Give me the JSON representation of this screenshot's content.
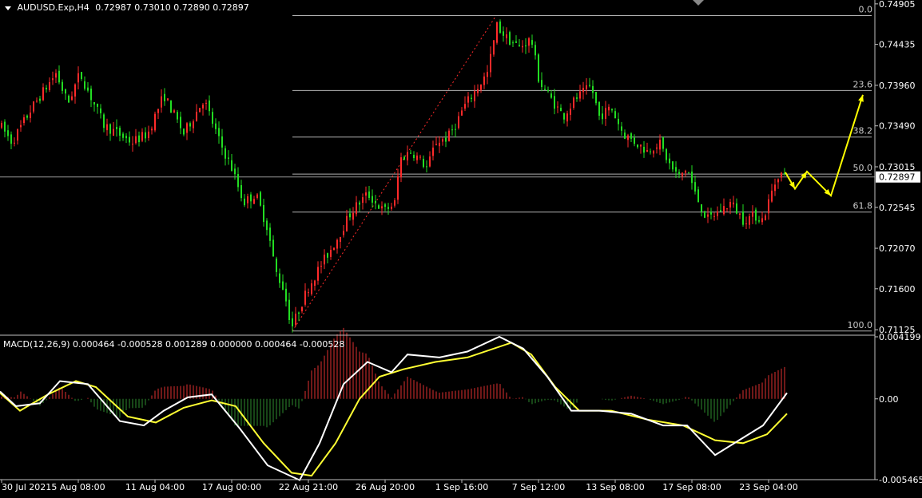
{
  "header": {
    "symbol": "AUDUSD.Exp,H4",
    "ohlc": "0.72987 0.73010 0.72890 0.72897"
  },
  "colors": {
    "background": "#000000",
    "bull": "#ff2a2a",
    "bear": "#22dd22",
    "grid": "#c0c0c0",
    "fib": "#b0b0b0",
    "fib_trend": "#ff2a2a",
    "macd_line": "#ffffff",
    "signal_line": "#ffff33",
    "hist_pos": "#e03030",
    "hist_neg": "#2e8b2e",
    "projection": "#ffff00"
  },
  "price_axis": {
    "ticks": [
      "0.74905",
      "0.74435",
      "0.73960",
      "0.73490",
      "0.73015",
      "0.72545",
      "0.72070",
      "0.71600",
      "0.71125"
    ],
    "current": "0.72897"
  },
  "fib_levels": [
    {
      "label": "0.0",
      "price": 0.7477
    },
    {
      "label": "23.6",
      "price": 0.739
    },
    {
      "label": "38.2",
      "price": 0.7336
    },
    {
      "label": "50.0",
      "price": 0.7293
    },
    {
      "label": "61.8",
      "price": 0.7249
    },
    {
      "label": "100.0",
      "price": 0.7111
    }
  ],
  "macd": {
    "label": "MACD(12,26,9) 0.000464 -0.000528 0.001289 0.000000 0.000464 -0.000528",
    "ticks": [
      "0.004199",
      "0.00",
      "-0.005465"
    ]
  },
  "time_axis": {
    "labels": [
      "30 Jul 2021",
      "5 Aug 08:00",
      "11 Aug 04:00",
      "17 Aug 00:00",
      "22 Aug 21:00",
      "26 Aug 20:00",
      "1 Sep 16:00",
      "7 Sep 12:00",
      "13 Sep 08:00",
      "17 Sep 08:00",
      "23 Sep 04:00"
    ]
  },
  "chart_data": [
    {
      "type": "candlestick",
      "symbol": "AUDUSD.Exp",
      "timeframe": "H4",
      "ylim": [
        0.7108,
        0.7495
      ],
      "price_path": [
        [
          0,
          0.735
        ],
        [
          15,
          0.733
        ],
        [
          40,
          0.737
        ],
        [
          70,
          0.741
        ],
        [
          85,
          0.7375
        ],
        [
          100,
          0.741
        ],
        [
          130,
          0.735
        ],
        [
          165,
          0.733
        ],
        [
          185,
          0.734
        ],
        [
          205,
          0.7385
        ],
        [
          230,
          0.734
        ],
        [
          255,
          0.738
        ],
        [
          275,
          0.733
        ],
        [
          290,
          0.73
        ],
        [
          305,
          0.726
        ],
        [
          320,
          0.727
        ],
        [
          335,
          0.723
        ],
        [
          345,
          0.718
        ],
        [
          355,
          0.716
        ],
        [
          365,
          0.7115
        ],
        [
          385,
          0.716
        ],
        [
          400,
          0.7185
        ],
        [
          420,
          0.7215
        ],
        [
          440,
          0.725
        ],
        [
          460,
          0.727
        ],
        [
          480,
          0.725
        ],
        [
          495,
          0.726
        ],
        [
          500,
          0.731
        ],
        [
          515,
          0.732
        ],
        [
          535,
          0.73
        ],
        [
          545,
          0.733
        ],
        [
          560,
          0.7335
        ],
        [
          570,
          0.735
        ],
        [
          580,
          0.737
        ],
        [
          595,
          0.739
        ],
        [
          610,
          0.741
        ],
        [
          622,
          0.7465
        ],
        [
          635,
          0.745
        ],
        [
          650,
          0.744
        ],
        [
          665,
          0.745
        ],
        [
          675,
          0.74
        ],
        [
          690,
          0.738
        ],
        [
          705,
          0.736
        ],
        [
          720,
          0.738
        ],
        [
          740,
          0.7395
        ],
        [
          750,
          0.736
        ],
        [
          765,
          0.737
        ],
        [
          780,
          0.734
        ],
        [
          795,
          0.733
        ],
        [
          810,
          0.732
        ],
        [
          825,
          0.733
        ],
        [
          840,
          0.73
        ],
        [
          850,
          0.729
        ],
        [
          860,
          0.73
        ],
        [
          870,
          0.727
        ],
        [
          885,
          0.724
        ],
        [
          900,
          0.725
        ],
        [
          915,
          0.726
        ],
        [
          930,
          0.724
        ],
        [
          945,
          0.7245
        ],
        [
          955,
          0.724
        ],
        [
          965,
          0.727
        ],
        [
          975,
          0.7295
        ],
        [
          983,
          0.729
        ]
      ],
      "fib_retracement": {
        "high": 0.7477,
        "low": 0.7111
      },
      "projection": [
        [
          983,
          0.7295
        ],
        [
          995,
          0.7276
        ],
        [
          1010,
          0.7296
        ],
        [
          1040,
          0.7268
        ],
        [
          1080,
          0.7385
        ]
      ]
    },
    {
      "type": "line",
      "indicator": "MACD(12,26,9)",
      "ylim": [
        -0.005465,
        0.004199
      ],
      "series": [
        {
          "name": "MACD",
          "points": [
            [
              0,
              0.0005
            ],
            [
              20,
              -0.0005
            ],
            [
              50,
              -0.0003
            ],
            [
              75,
              0.0012
            ],
            [
              110,
              0.001
            ],
            [
              150,
              -0.0015
            ],
            [
              180,
              -0.0018
            ],
            [
              205,
              -0.0008
            ],
            [
              235,
              0.0001
            ],
            [
              265,
              0.0003
            ],
            [
              300,
              -0.002
            ],
            [
              335,
              -0.0045
            ],
            [
              375,
              -0.0055
            ],
            [
              400,
              -0.003
            ],
            [
              430,
              0.001
            ],
            [
              460,
              0.0025
            ],
            [
              490,
              0.0018
            ],
            [
              510,
              0.003
            ],
            [
              550,
              0.0028
            ],
            [
              585,
              0.0032
            ],
            [
              625,
              0.0042
            ],
            [
              655,
              0.0034
            ],
            [
              685,
              0.0015
            ],
            [
              715,
              -0.0008
            ],
            [
              750,
              -0.0008
            ],
            [
              790,
              -0.001
            ],
            [
              830,
              -0.0018
            ],
            [
              860,
              -0.0018
            ],
            [
              895,
              -0.0038
            ],
            [
              925,
              -0.0028
            ],
            [
              955,
              -0.0018
            ],
            [
              985,
              0.0004
            ]
          ]
        },
        {
          "name": "Signal",
          "points": [
            [
              0,
              0.0004
            ],
            [
              25,
              -0.0008
            ],
            [
              60,
              0.0003
            ],
            [
              95,
              0.0012
            ],
            [
              120,
              0.0008
            ],
            [
              160,
              -0.0012
            ],
            [
              195,
              -0.0016
            ],
            [
              230,
              -0.0006
            ],
            [
              265,
              -0.0001
            ],
            [
              295,
              -0.0005
            ],
            [
              330,
              -0.003
            ],
            [
              365,
              -0.005
            ],
            [
              390,
              -0.0052
            ],
            [
              420,
              -0.003
            ],
            [
              450,
              0.0
            ],
            [
              475,
              0.0015
            ],
            [
              505,
              0.002
            ],
            [
              545,
              0.0025
            ],
            [
              585,
              0.0028
            ],
            [
              640,
              0.0038
            ],
            [
              665,
              0.003
            ],
            [
              695,
              0.0008
            ],
            [
              725,
              -0.0008
            ],
            [
              765,
              -0.0008
            ],
            [
              810,
              -0.0014
            ],
            [
              855,
              -0.0018
            ],
            [
              895,
              -0.0028
            ],
            [
              930,
              -0.003
            ],
            [
              960,
              -0.0024
            ],
            [
              985,
              -0.001
            ]
          ]
        }
      ],
      "histogram_note": "MACD minus Signal shown as red (positive) / green (negative) bars"
    }
  ]
}
